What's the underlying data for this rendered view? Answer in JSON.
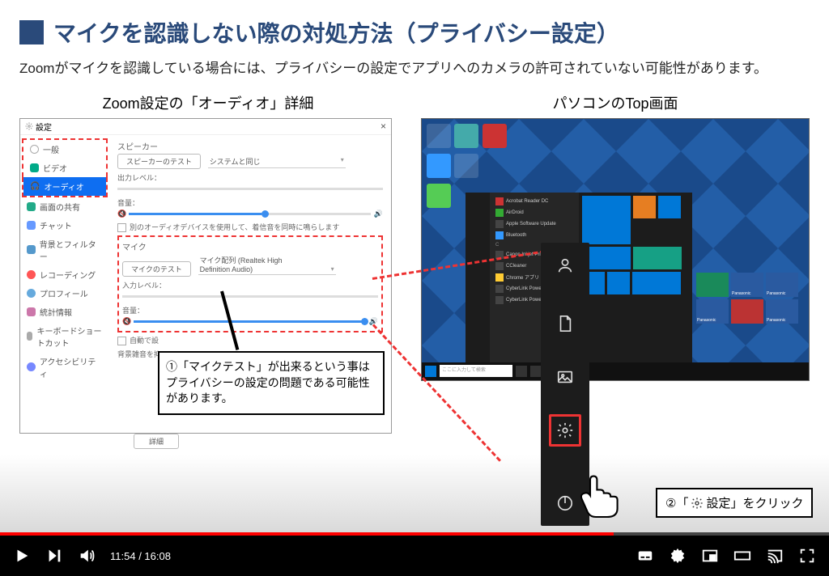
{
  "slide": {
    "title": "マイクを認識しない際の対処方法（プライバシー設定）",
    "subtitle": "Zoomがマイクを認識している場合には、プライバシーの設定でアプリへのカメラの許可されていない可能性があります。"
  },
  "left": {
    "caption": "Zoom設定の「オーディオ」詳細",
    "window_title": "設定",
    "sidebar": [
      {
        "label": "一般",
        "color": "#999"
      },
      {
        "label": "ビデオ",
        "color": "#0a8"
      },
      {
        "label": "オーディオ",
        "color": "#fff",
        "selected": true
      },
      {
        "label": "画面の共有",
        "color": "#2a8"
      },
      {
        "label": "チャット",
        "color": "#69f"
      },
      {
        "label": "背景とフィルター",
        "color": "#59c"
      },
      {
        "label": "レコーディング",
        "color": "#f55"
      },
      {
        "label": "プロフィール",
        "color": "#6ad"
      },
      {
        "label": "統計情報",
        "color": "#c7a"
      },
      {
        "label": "キーボードショートカット",
        "color": "#aaa"
      },
      {
        "label": "アクセシビリティ",
        "color": "#78f"
      }
    ],
    "speaker": {
      "title": "スピーカー",
      "test": "スピーカーのテスト",
      "device": "システムと同じ",
      "out_label": "出力レベル：",
      "vol_label": "音量：",
      "note": "別のオーディオデバイスを使用して、着信音を同時に鳴らします"
    },
    "mic": {
      "title": "マイク",
      "test": "マイクのテスト",
      "device": "マイク配列 (Realtek High Definition Audio)",
      "in_label": "入力レベル：",
      "vol_label": "音量：",
      "auto": "自動で設",
      "suppress": "背景雑音を抑"
    },
    "detail": "詳細",
    "callout": "①「マイクテスト」が出来るという事はプライバシーの設定の問題である可能性があります。"
  },
  "right": {
    "caption": "パソコンのTop画面",
    "callout": "②「     設定」をクリック",
    "callout_prefix": "②「",
    "callout_suffix": "設定」をクリック",
    "search_placeholder": "ここに入力して検索",
    "tiles": [
      "Panasonic",
      "Panasonic",
      "Panasonic",
      "Panasonic"
    ],
    "sm_items": [
      "Acrobat Reader DC",
      "AirDroid",
      "Apple Software Update",
      "Bluetooth",
      "",
      "Canon Inkjet Print Utility",
      "CCleaner",
      "Chrome アプリ",
      "CyberLink PowerDirector",
      "CyberLink PowerDVD 14"
    ]
  },
  "player": {
    "current": "11:54",
    "duration": "16:08",
    "progress_pct": 74
  }
}
